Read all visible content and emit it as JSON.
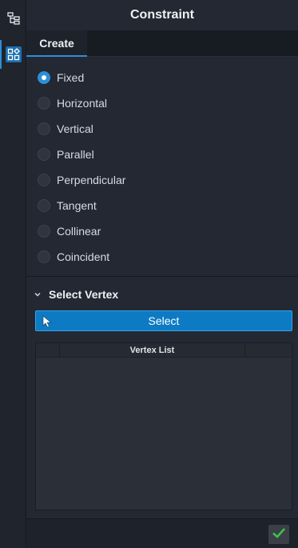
{
  "panel": {
    "title": "Constraint"
  },
  "tabs": [
    {
      "label": "Create",
      "active": true
    }
  ],
  "constraint_types": [
    {
      "label": "Fixed",
      "selected": true
    },
    {
      "label": "Horizontal",
      "selected": false
    },
    {
      "label": "Vertical",
      "selected": false
    },
    {
      "label": "Parallel",
      "selected": false
    },
    {
      "label": "Perpendicular",
      "selected": false
    },
    {
      "label": "Tangent",
      "selected": false
    },
    {
      "label": "Collinear",
      "selected": false
    },
    {
      "label": "Coincident",
      "selected": false
    }
  ],
  "select_vertex": {
    "title": "Select Vertex",
    "button_label": "Select",
    "list_header": "Vertex List",
    "rows": []
  },
  "rail": {
    "icons": [
      "tree-icon",
      "constraint-icon"
    ]
  },
  "colors": {
    "accent": "#2d8fd6",
    "button_blue": "#0d7ac4",
    "confirm_green": "#3fbf4a",
    "panel_bg": "#232832"
  }
}
